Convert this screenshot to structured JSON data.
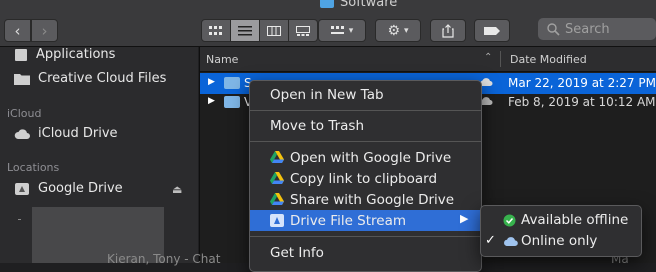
{
  "window": {
    "title": "Software"
  },
  "toolbar": {
    "search_placeholder": "Search"
  },
  "sidebar": {
    "favorites": [
      {
        "label": "Applications",
        "icon": "applications-folder-icon"
      },
      {
        "label": "Creative Cloud Files",
        "icon": "folder-icon"
      }
    ],
    "icloud_header": "iCloud",
    "icloud_items": [
      {
        "label": "iCloud Drive",
        "icon": "cloud-icon"
      }
    ],
    "locations_header": "Locations",
    "locations_items": [
      {
        "label": "Google Drive",
        "icon": "drive-disk-icon"
      }
    ],
    "eject_icon": "⏏"
  },
  "list": {
    "columns": {
      "name": "Name",
      "date": "Date Modified"
    },
    "rows": [
      {
        "name": "S",
        "date": "Mar 22, 2019 at 2:27 PM",
        "selected": true
      },
      {
        "name": "V",
        "date": "Feb 8, 2019 at 10:12 AM",
        "selected": false
      }
    ],
    "bottom_partial_left": "Kieran, Tony - Chat",
    "bottom_partial_right": "Ma"
  },
  "context_menu": {
    "items": [
      {
        "label": "Open in New Tab"
      },
      {
        "label": "Move to Trash"
      },
      {
        "label": "Open with Google Drive"
      },
      {
        "label": "Copy link to clipboard"
      },
      {
        "label": "Share with Google Drive"
      },
      {
        "label": "Drive File Stream"
      },
      {
        "label": "Get Info"
      }
    ]
  },
  "submenu": {
    "items": [
      {
        "label": "Available offline",
        "checked": false
      },
      {
        "label": "Online only",
        "checked": true
      }
    ],
    "check_glyph": "✓"
  },
  "colors": {
    "selection": "#0a64d8",
    "menu_highlight": "#2f6ed6",
    "available_offline_green": "#37b24d"
  }
}
